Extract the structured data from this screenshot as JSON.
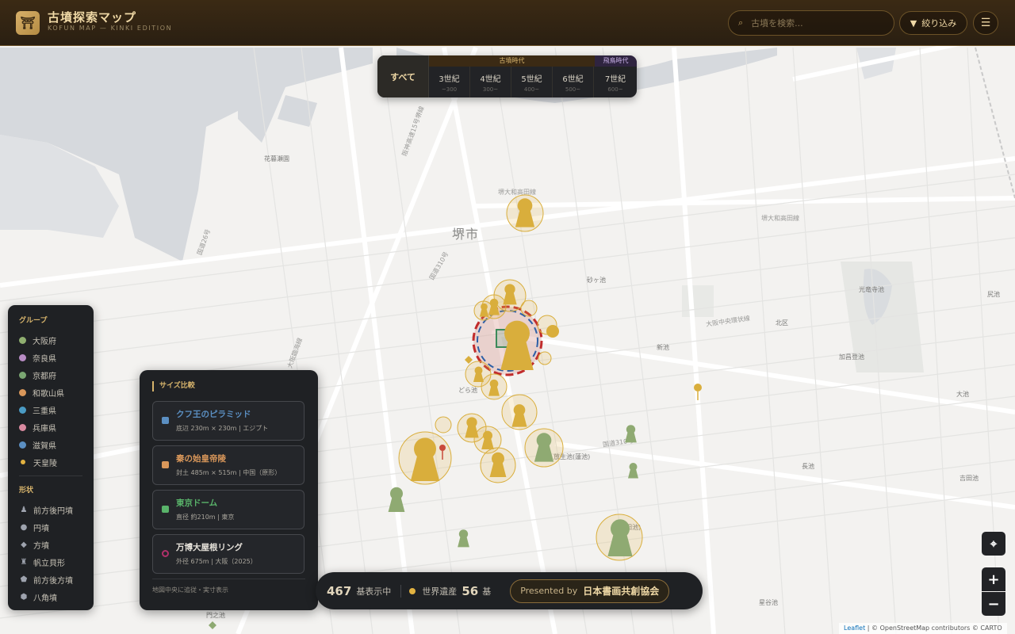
{
  "header": {
    "logo_glyph": "⛩",
    "title": "古墳探索マップ",
    "subtitle": "KOFUN MAP — KINKI EDITION",
    "search_placeholder": "古墳を検索...",
    "search_icon": "search-icon",
    "filter_label": "絞り込み",
    "filter_icon": "filter-icon",
    "menu_icon": "hamburger-menu-icon"
  },
  "era_selector": {
    "all_label": "すべて",
    "group_kofun": "古墳時代",
    "group_asuka": "飛鳥時代",
    "eras": [
      {
        "label": "3世紀",
        "sub": "~300"
      },
      {
        "label": "4世紀",
        "sub": "300~"
      },
      {
        "label": "5世紀",
        "sub": "400~"
      },
      {
        "label": "6世紀",
        "sub": "500~"
      },
      {
        "label": "7世紀",
        "sub": "600~"
      }
    ]
  },
  "legend": {
    "group_title": "グループ",
    "groups": [
      {
        "label": "大阪府",
        "color": "#8fae6f"
      },
      {
        "label": "奈良県",
        "color": "#b88cc4"
      },
      {
        "label": "京都府",
        "color": "#7aa672"
      },
      {
        "label": "和歌山県",
        "color": "#d9975a"
      },
      {
        "label": "三重県",
        "color": "#4a9bc4"
      },
      {
        "label": "兵庫県",
        "color": "#d98aa0"
      },
      {
        "label": "滋賀県",
        "color": "#5b8fc2"
      },
      {
        "label": "天皇陵",
        "color": "#e2b241"
      }
    ],
    "shape_title": "形状",
    "shapes": [
      {
        "label": "前方後円墳",
        "icon": "keyhole-icon",
        "glyph": "♟"
      },
      {
        "label": "円墳",
        "icon": "circle-icon",
        "glyph": "●"
      },
      {
        "label": "方墳",
        "icon": "diamond-icon",
        "glyph": "◆"
      },
      {
        "label": "帆立貝形",
        "icon": "scallop-icon",
        "glyph": "♜"
      },
      {
        "label": "前方後方墳",
        "icon": "shield-icon",
        "glyph": "⬟"
      },
      {
        "label": "八角墳",
        "icon": "octagon-icon",
        "glyph": "⬢"
      }
    ]
  },
  "size_compare": {
    "title": "サイズ比較",
    "items": [
      {
        "name": "クフ王のピラミッド",
        "desc": "底辺 230m × 230m | エジプト",
        "color": "#5b8fc2"
      },
      {
        "name": "秦の始皇帝陵",
        "desc": "封土 485m × 515m | 中国（原形）",
        "color": "#d9975a"
      },
      {
        "name": "東京ドーム",
        "desc": "直径 約210m | 東京",
        "color": "#59b36a"
      },
      {
        "name": "万博大屋根リング",
        "desc": "外径 675m | 大阪（2025）",
        "color": "#e6e2da"
      }
    ],
    "note": "地図中央に追従・実寸表示"
  },
  "stats": {
    "count": "467",
    "count_label": "基表示中",
    "wh_label": "世界遺産",
    "wh_count": "56",
    "wh_unit": "基",
    "presented_by": "Presented by",
    "presenter": "日本書画共創協会"
  },
  "map": {
    "city_label": "堺市",
    "labels": [
      "花暮瀬園",
      "どら池",
      "北区",
      "新池",
      "光竜寺池",
      "加昌登池",
      "砂ヶ池",
      "大池",
      "放生池(蓮池)",
      "長池",
      "吉田池",
      "星谷池",
      "門之池",
      "尻池",
      "(山田池)"
    ],
    "road_labels": [
      "阪神高速15号堺線",
      "堺大和高田線",
      "大阪中央環状線",
      "国道310号",
      "堺大和高田線",
      "大阪臨海線",
      "国道26号",
      "国道310号"
    ]
  },
  "controls": {
    "locate_icon": "crosshair-icon",
    "zoom_in": "+",
    "zoom_out": "−"
  },
  "attribution": {
    "leaflet": "Leaflet",
    "text": "| © OpenStreetMap contributors © CARTO"
  }
}
